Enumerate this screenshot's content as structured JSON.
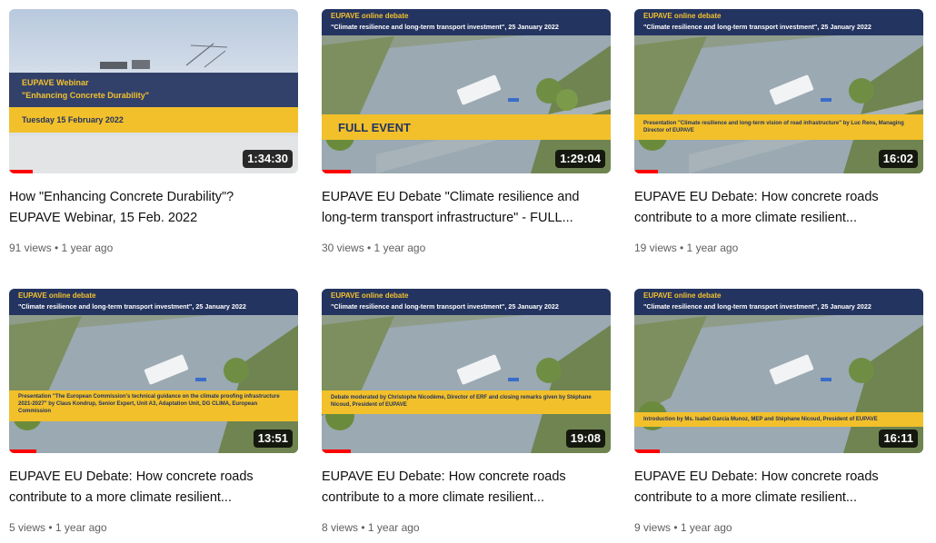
{
  "videos": [
    {
      "title_line1": "How \"Enhancing Concrete Durability\"?",
      "title_line2": "EUPAVE Webinar, 15 Feb. 2022",
      "meta": "91 views • 1 year ago",
      "duration": "1:34:30",
      "progress": 0.08,
      "thumb": {
        "kind": "webinar",
        "line1": "EUPAVE Webinar",
        "line2": "\"Enhancing Concrete Durability\"",
        "date": "Tuesday 15 February 2022"
      }
    },
    {
      "title_line1": "EUPAVE EU Debate \"Climate resilience and",
      "title_line2": "long-term transport infrastructure\" - FULL...",
      "meta": "30 views • 1 year ago",
      "duration": "1:29:04",
      "progress": 0.1,
      "thumb": {
        "kind": "debate",
        "band1": "EUPAVE online debate",
        "band2": "\"Climate resilience and long-term transport investment\", 25 January 2022",
        "caption": "FULL EVENT"
      }
    },
    {
      "title_line1": "EUPAVE EU Debate: How concrete roads",
      "title_line2": "contribute to a more climate resilient...",
      "meta": "19 views • 1 year ago",
      "duration": "16:02",
      "progress": 0.08,
      "thumb": {
        "kind": "debate",
        "band1": "EUPAVE online debate",
        "band2": "\"Climate resilience and long-term transport investment\", 25 January 2022",
        "caption": "Presentation \"Climate resilience and long-term vision of road infrastructure\" by Luc Rens, Managing Director of EUPAVE"
      }
    },
    {
      "title_line1": "EUPAVE EU Debate: How concrete roads",
      "title_line2": "contribute to a more climate resilient...",
      "meta": "5 views • 1 year ago",
      "duration": "13:51",
      "progress": 0.09,
      "thumb": {
        "kind": "debate",
        "band1": "EUPAVE online debate",
        "band2": "\"Climate resilience and long-term transport investment\", 25 January 2022",
        "caption": "Presentation \"The European Commission's technical guidance on the climate proofing infrastructure 2021-2027\" by Claus Kondrup, Senior Expert, Unit A3, Adaptation Unit, DG CLIMA, European Commission"
      }
    },
    {
      "title_line1": "EUPAVE EU Debate: How concrete roads",
      "title_line2": "contribute to a more climate resilient...",
      "meta": "8 views • 1 year ago",
      "duration": "19:08",
      "progress": 0.1,
      "thumb": {
        "kind": "debate",
        "band1": "EUPAVE online debate",
        "band2": "\"Climate resilience and long-term transport investment\", 25 January 2022",
        "caption": "Debate moderated by Christophe Nicodème, Director of ERF and closing remarks given by Stéphane Nicoud, President of EUPAVE"
      }
    },
    {
      "title_line1": "EUPAVE EU Debate: How concrete roads",
      "title_line2": "contribute to a more climate resilient...",
      "meta": "9 views • 1 year ago",
      "duration": "16:11",
      "progress": 0.09,
      "thumb": {
        "kind": "debate",
        "band1": "EUPAVE online debate",
        "band2": "\"Climate resilience and long-term transport investment\", 25 January 2022",
        "caption": "Introduction by Ms. Isabel Garcia Munoz, MEP and Stéphane Nicoud, President of EUPAVE"
      }
    }
  ]
}
